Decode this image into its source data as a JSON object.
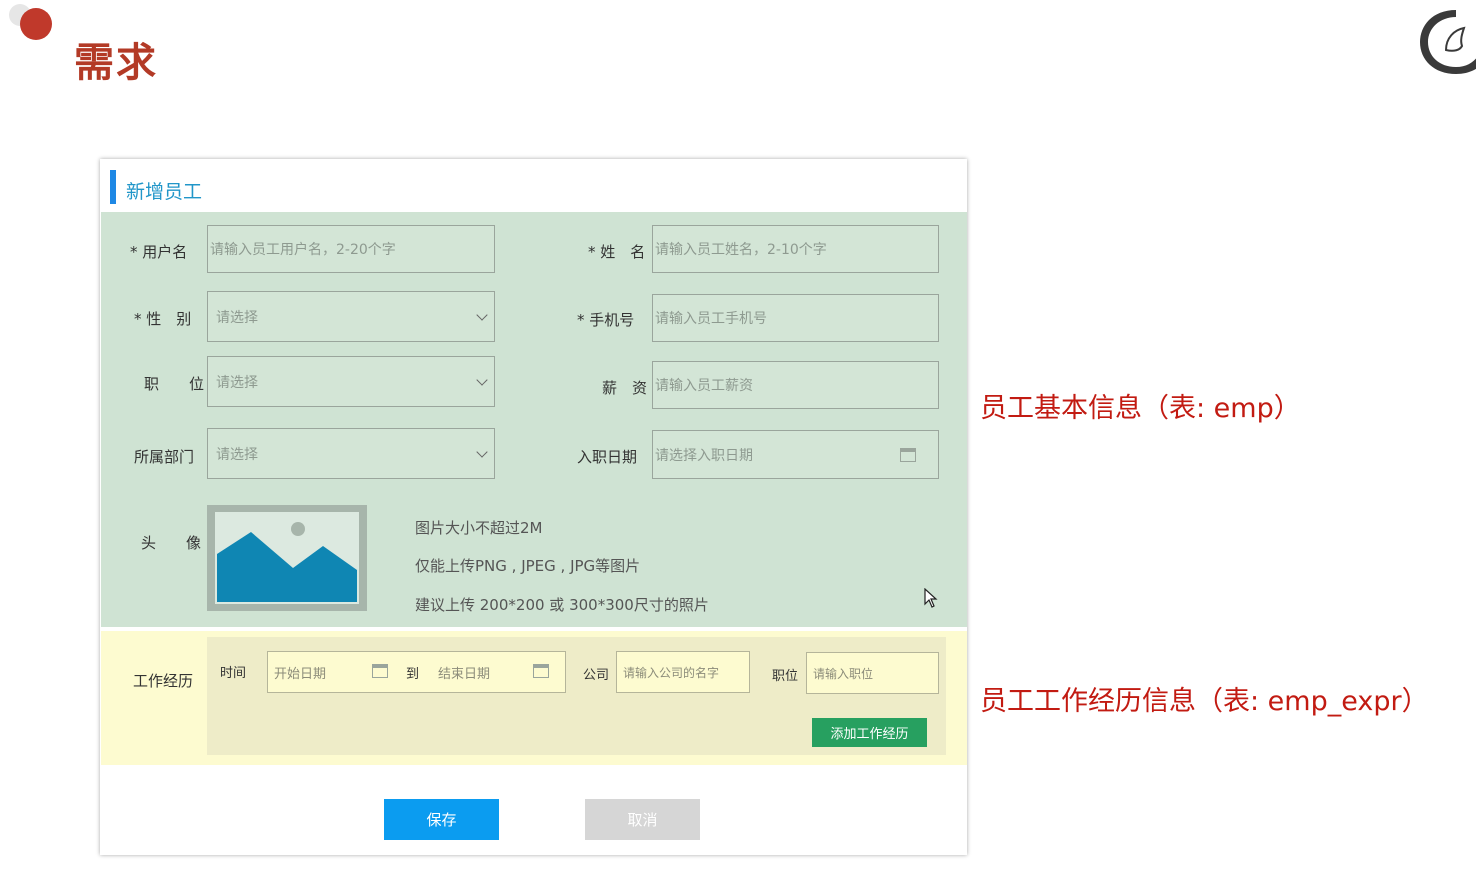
{
  "slide": {
    "title": "需求",
    "note_basic": "员工基本信息（表: emp）",
    "note_expr": "员工工作经历信息（表: emp_expr）"
  },
  "form": {
    "title": "新增员工",
    "username": {
      "label": "* 用户名",
      "placeholder": "请输入员工用户名，2-20个字"
    },
    "name": {
      "label": "* 姓　名",
      "placeholder": "请输入员工姓名，2-10个字"
    },
    "gender": {
      "label": "* 性　别",
      "placeholder": "请选择"
    },
    "phone": {
      "label": "* 手机号",
      "placeholder": "请输入员工手机号"
    },
    "position": {
      "label": "职　　位",
      "placeholder": "请选择"
    },
    "salary": {
      "label": "薪　资",
      "placeholder": "请输入员工薪资"
    },
    "dept": {
      "label": "所属部门",
      "placeholder": "请选择"
    },
    "entry_date": {
      "label": "入职日期",
      "placeholder": "请选择入职日期"
    },
    "avatar": {
      "label": "头　　像",
      "tips": [
        "图片大小不超过2M",
        "仅能上传PNG , JPEG , JPG等图片",
        "建议上传 200*200 或 300*300尺寸的照片"
      ]
    },
    "work": {
      "label": "工作经历",
      "time_label": "时间",
      "start_placeholder": "开始日期",
      "to_label": "到",
      "end_placeholder": "结束日期",
      "company_label": "公司",
      "company_placeholder": "请输入公司的名字",
      "job_label": "职位",
      "job_placeholder": "请输入职位",
      "add_button": "添加工作经历"
    },
    "save_button": "保存",
    "cancel_button": "取消"
  },
  "colors": {
    "accent": "#0b9cf0",
    "basic_bg": "#cfe3d3",
    "expr_bg": "#fdfbd0",
    "add_button": "#27a060",
    "note": "#c21b12"
  },
  "icons": [
    "calendar-icon",
    "chevron-down-icon",
    "image-placeholder-icon",
    "cursor-icon",
    "logo-icon"
  ]
}
